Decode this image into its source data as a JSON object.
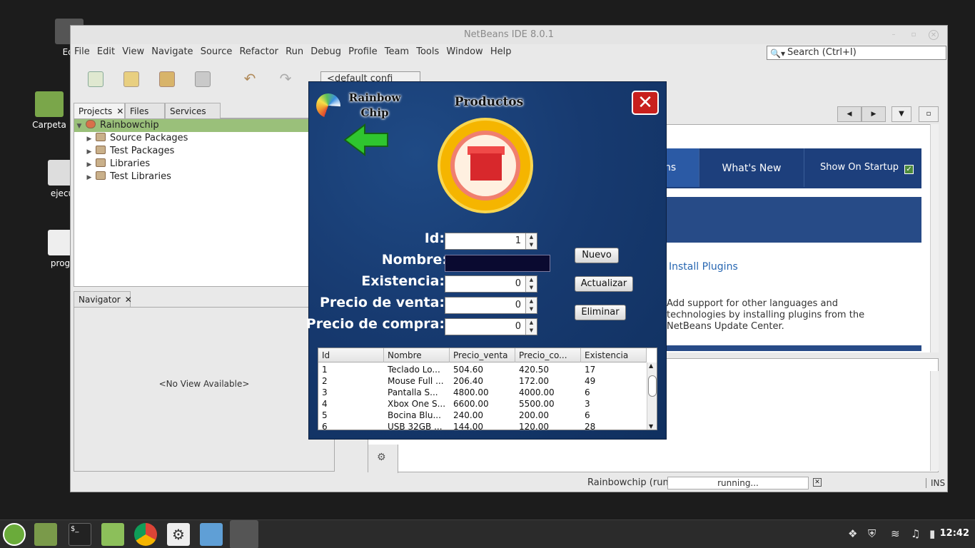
{
  "desktop": {
    "icons": [
      {
        "label": "Equ"
      },
      {
        "label": "Carpeta"
      },
      {
        "label": "ejecu"
      },
      {
        "label": "progr"
      }
    ]
  },
  "netbeans": {
    "title": "NetBeans IDE 8.0.1",
    "menu": [
      "File",
      "Edit",
      "View",
      "Navigate",
      "Source",
      "Refactor",
      "Run",
      "Debug",
      "Profile",
      "Team",
      "Tools",
      "Window",
      "Help"
    ],
    "search_placeholder": "Search (Ctrl+I)",
    "config_select": "<default confi",
    "tabs": [
      "Projects",
      "Files",
      "Services"
    ],
    "project": {
      "root": "Rainbowchip",
      "children": [
        "Source Packages",
        "Test Packages",
        "Libraries",
        "Test Libraries"
      ]
    },
    "navigator": {
      "tab": "Navigator",
      "empty_text": "<No View Available>"
    },
    "start_page": {
      "tab_partial": "ns",
      "whats_new": "What's New",
      "show_on_startup": "Show On Startup",
      "install_plugins": "Install Plugins",
      "description": "Add support for other languages and technologies by installing plugins from the NetBeans Update Center."
    },
    "status": {
      "run_label": "Rainbowchip (run)",
      "progress_text": "running...",
      "mode": "INS"
    }
  },
  "dialog": {
    "logo_text": "Rainbow Chip",
    "title": "Productos",
    "close_symbol": "✕",
    "labels": {
      "id": "Id:",
      "nombre": "Nombre:",
      "existencia": "Existencia:",
      "precio_venta": "Precio de venta:",
      "precio_compra": "Precio de compra:"
    },
    "values": {
      "id": "1",
      "existencia": "0",
      "precio_venta": "0",
      "precio_compra": "0"
    },
    "buttons": {
      "nuevo": "Nuevo",
      "actualizar": "Actualizar",
      "eliminar": "Eliminar"
    },
    "table": {
      "headers": [
        "Id",
        "Nombre",
        "Precio_venta",
        "Precio_co...",
        "Existencia"
      ],
      "rows": [
        [
          "1",
          "Teclado Lo...",
          "504.60",
          "420.50",
          "17"
        ],
        [
          "2",
          "Mouse Full ...",
          "206.40",
          "172.00",
          "49"
        ],
        [
          "3",
          "Pantalla S...",
          "4800.00",
          "4000.00",
          "6"
        ],
        [
          "4",
          "Xbox One S...",
          "6600.00",
          "5500.00",
          "3"
        ],
        [
          "5",
          "Bocina Blu...",
          "240.00",
          "200.00",
          "6"
        ],
        [
          "6",
          "USB 32GB ...",
          "144.00",
          "120.00",
          "28"
        ]
      ]
    }
  },
  "taskbar": {
    "clock": "12:42"
  }
}
